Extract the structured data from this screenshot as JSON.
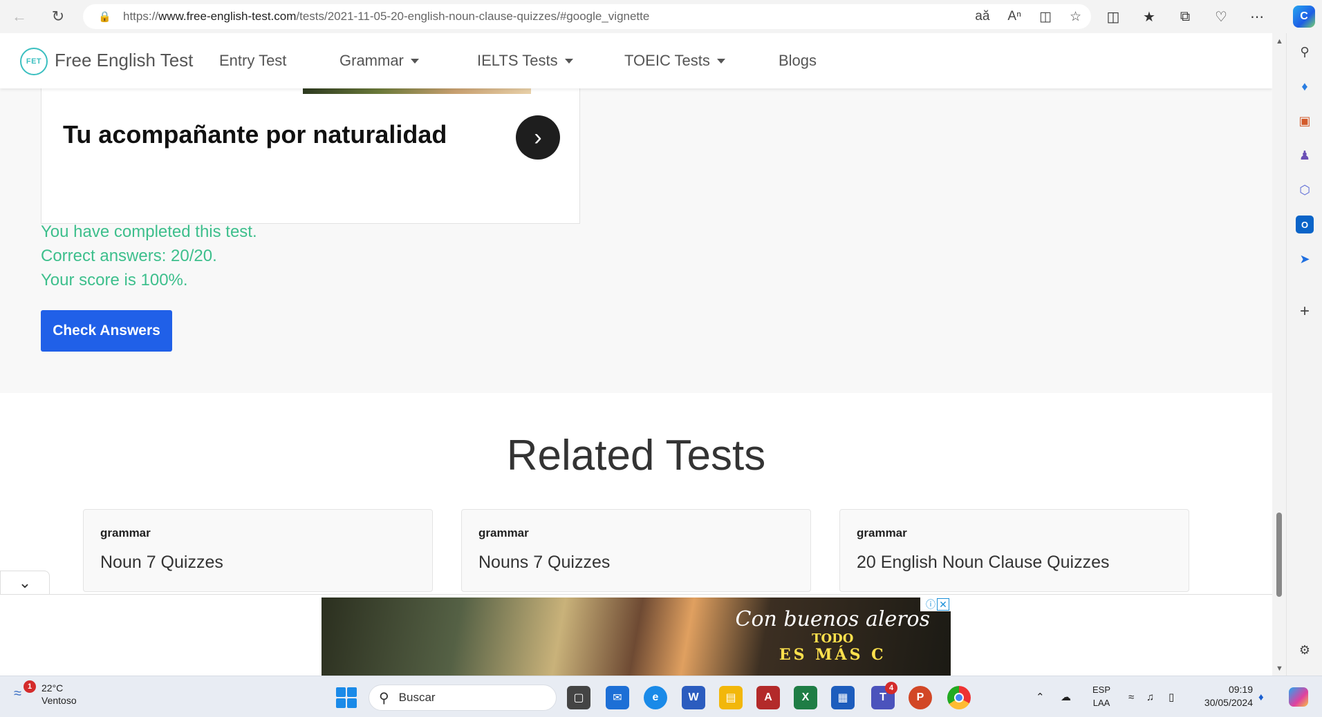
{
  "browser": {
    "url_prefix": "https://",
    "url_host": "www.free-english-test.com",
    "url_path": "/tests/2021-11-05-20-english-noun-clause-quizzes/#google_vignette"
  },
  "site": {
    "logo_mark": "FET",
    "logo_text": "Free English Test",
    "nav": [
      {
        "label": "Entry Test"
      },
      {
        "label": "Grammar"
      },
      {
        "label": "IELTS Tests"
      },
      {
        "label": "TOEIC Tests"
      },
      {
        "label": "Blogs"
      }
    ]
  },
  "ad_top": {
    "headline": "Tu acompañante por naturalidad"
  },
  "result": {
    "line1": "You have completed this test.",
    "line2": "Correct answers: 20/20.",
    "line3": "Your score is 100%.",
    "check_button": "Check Answers"
  },
  "related": {
    "title": "Related Tests",
    "cards": [
      {
        "category": "grammar",
        "name": "Noun 7 Quizzes"
      },
      {
        "category": "grammar",
        "name": "Nouns 7 Quizzes"
      },
      {
        "category": "grammar",
        "name": "20 English Noun Clause Quizzes"
      }
    ]
  },
  "ad_bottom": {
    "slogan_1": "Con buenos aleros",
    "slogan_2": "TODO",
    "slogan_3": "ES MÁS C"
  },
  "taskbar": {
    "weather_badge": "1",
    "temperature": "22°C",
    "weather_desc": "Ventoso",
    "search_placeholder": "Buscar",
    "teams_badge": "4",
    "lang_1": "ESP",
    "lang_2": "LAA",
    "time": "09:19",
    "date": "30/05/2024"
  },
  "colors": {
    "accent_blue": "#2060e8",
    "success_green": "#3dbf8c",
    "logo_teal": "#3bbfc0"
  }
}
